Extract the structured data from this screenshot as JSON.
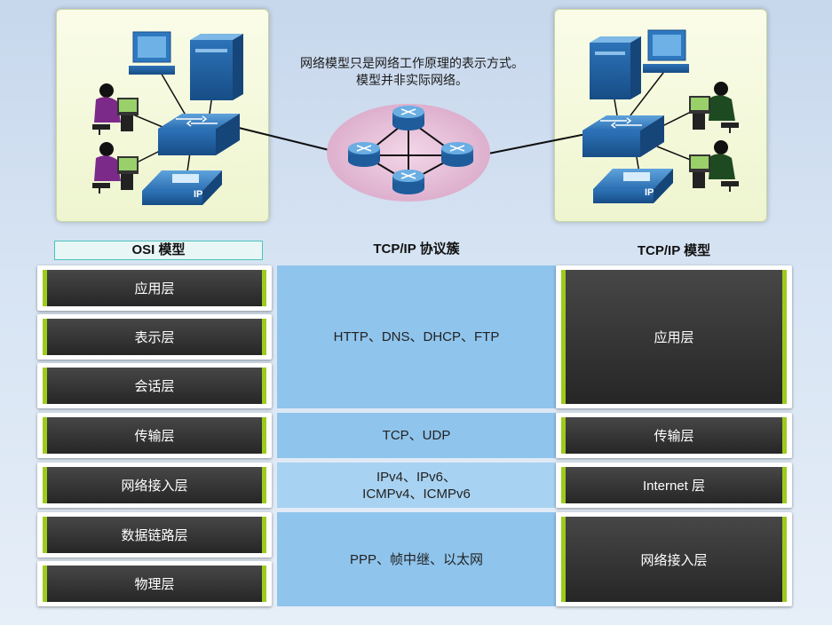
{
  "caption": {
    "line1": "网络模型只是网络工作原理的表示方式。",
    "line2": "模型并非实际网络。"
  },
  "headers": {
    "osi": "OSI 模型",
    "protocols": "TCP/IP 协议簇",
    "tcpip": "TCP/IP 模型"
  },
  "osi_layers": [
    "应用层",
    "表示层",
    "会话层",
    "传输层",
    "网络接入层",
    "数据链路层",
    "物理层"
  ],
  "protocol_bands": {
    "application": "HTTP、DNS、DHCP、FTP",
    "transport": "TCP、UDP",
    "internet_line1": "IPv4、IPv6、",
    "internet_line2": "ICMPv4、ICMPv6",
    "network_access": "PPP、帧中继、以太网"
  },
  "tcpip_layers": [
    "应用层",
    "传输层",
    "Internet 层",
    "网络接入层"
  ],
  "device_labels": {
    "ip_phone": "IP"
  },
  "colors": {
    "layer_accent": "#9ccb1c",
    "layer_body": "#333333",
    "protocol_band": "#8fc4ec",
    "panel": "#f3f8dc",
    "router_cloud": "#e8c3dc"
  }
}
